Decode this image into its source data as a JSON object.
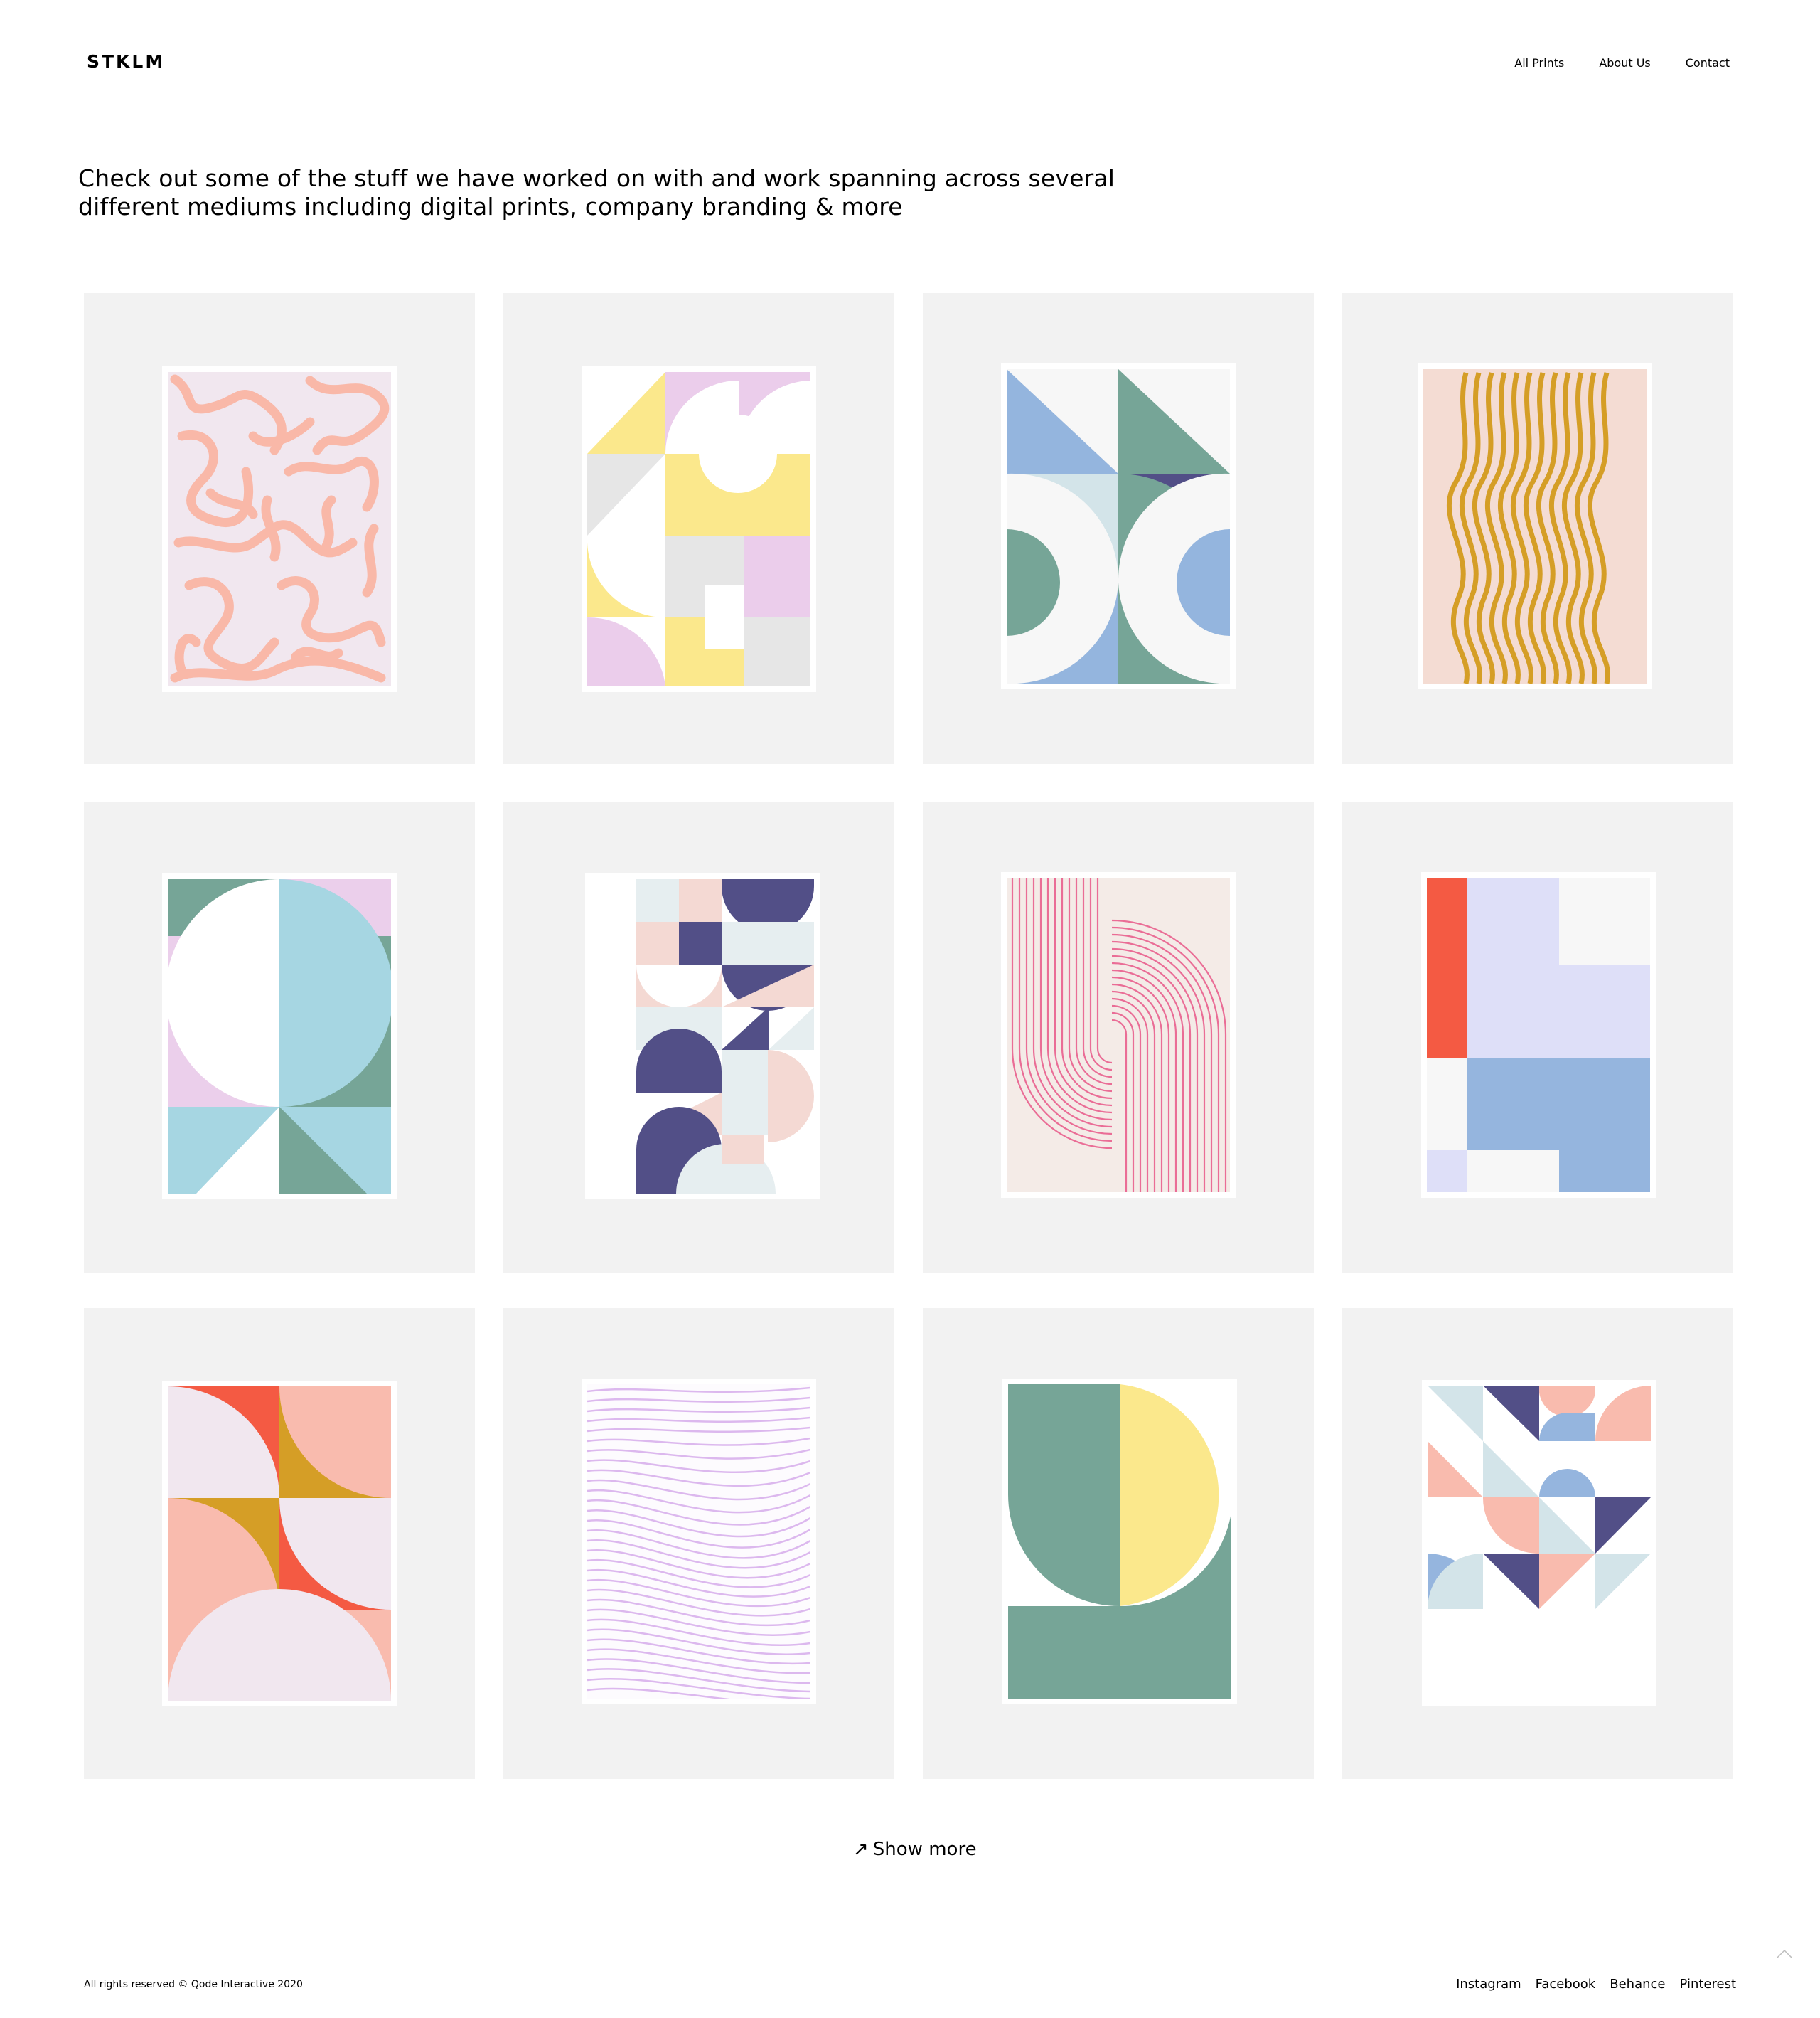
{
  "header": {
    "logo": "STKLM",
    "nav": [
      {
        "label": "All Prints",
        "active": true
      },
      {
        "label": "About Us",
        "active": false
      },
      {
        "label": "Contact",
        "active": false
      }
    ]
  },
  "intro": {
    "line1": "Check out some of the stuff we have worked on with and work spanning across several",
    "line2": "different mediums including digital prints, company branding & more"
  },
  "portfolio": {
    "items": [
      {
        "style": "pink-maze",
        "palette": [
          "#f9b8a8",
          "#f1e7ef"
        ]
      },
      {
        "style": "yellow-lilac-geometric",
        "palette": [
          "#fbe88c",
          "#ebcdeb",
          "#e6e6e6"
        ]
      },
      {
        "style": "blue-green-arches",
        "palette": [
          "#94b5de",
          "#76a597",
          "#524f87",
          "#d3e4e9"
        ]
      },
      {
        "style": "mustard-waves",
        "palette": [
          "#d59e26",
          "#f4dcd3"
        ]
      },
      {
        "style": "green-aqua-circle",
        "palette": [
          "#76a597",
          "#a6d6e2",
          "#ebcfeb"
        ]
      },
      {
        "style": "navy-grid-pattern",
        "palette": [
          "#524f87",
          "#f4d9d3",
          "#e6eef0"
        ]
      },
      {
        "style": "pink-line-arches",
        "palette": [
          "#ea6d96",
          "#f4ebe7"
        ]
      },
      {
        "style": "red-lavender-blocks",
        "palette": [
          "#f45a43",
          "#dedff8",
          "#95b5de"
        ]
      },
      {
        "style": "coral-quarter-circles",
        "palette": [
          "#f45a43",
          "#f9bbae",
          "#d59e26",
          "#f1e7ef"
        ]
      },
      {
        "style": "lavender-waves",
        "palette": [
          "#dcb8ee",
          "#fdfbfe"
        ]
      },
      {
        "style": "green-yellow-arch",
        "palette": [
          "#76a597",
          "#fbe88c"
        ]
      },
      {
        "style": "pastel-triangles",
        "palette": [
          "#524f87",
          "#f9bbae",
          "#d3e4e9",
          "#95b5de"
        ]
      }
    ]
  },
  "show_more": {
    "icon": "arrow-up-right-icon",
    "label": "Show more"
  },
  "footer": {
    "copyright": "All rights reserved © Qode Interactive 2020",
    "socials": [
      "Instagram",
      "Facebook",
      "Behance",
      "Pinterest"
    ]
  }
}
